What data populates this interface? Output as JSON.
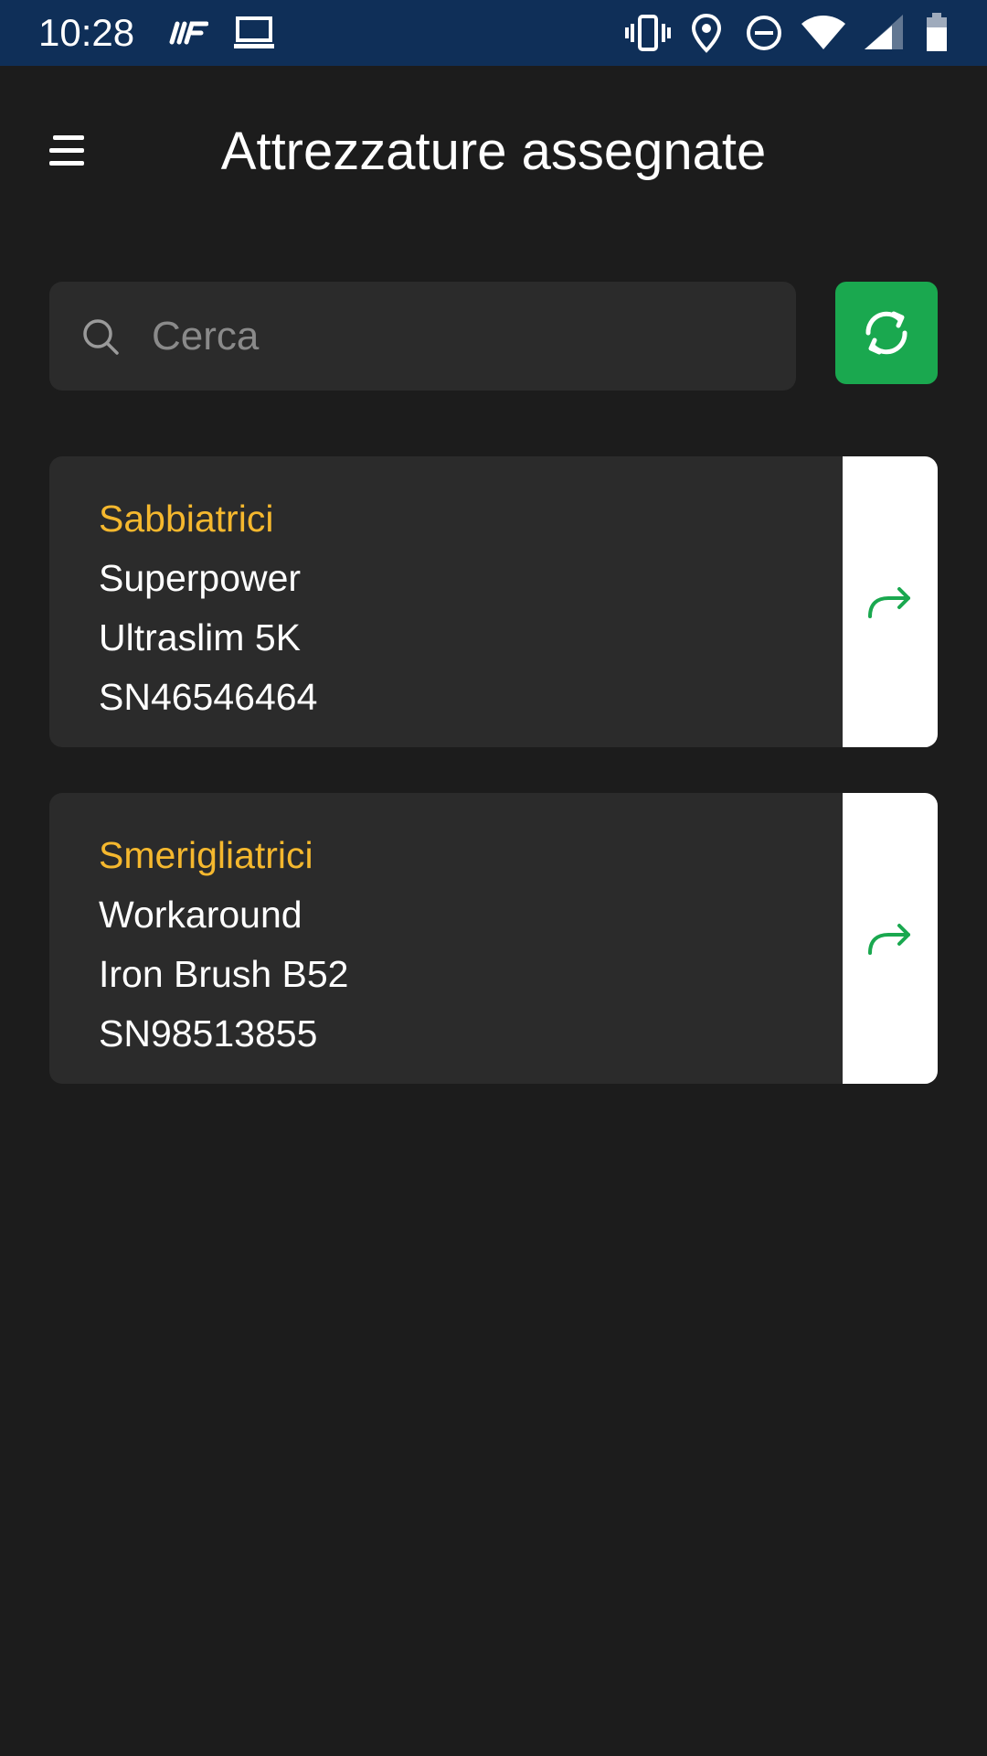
{
  "status_bar": {
    "time": "10:28",
    "icons": [
      "sim-icon",
      "laptop-icon",
      "vibrate-icon",
      "location-icon",
      "do-not-disturb-icon",
      "wifi-icon",
      "signal-icon",
      "battery-icon"
    ]
  },
  "header": {
    "title": "Attrezzature assegnate",
    "menu_icon": "menu-icon"
  },
  "search": {
    "placeholder": "Cerca",
    "value": "",
    "icon": "search-icon"
  },
  "refresh_button": {
    "icon": "refresh-icon",
    "color": "#1aa84f"
  },
  "colors": {
    "accent": "#1aa84f",
    "category": "#f5b82e",
    "status_bar": "#0f2f58",
    "background": "#1c1c1c",
    "card": "#2b2b2b"
  },
  "equipment": [
    {
      "category": "Sabbiatrici",
      "brand": "Superpower",
      "model": "Ultraslim 5K",
      "serial": "SN46546464",
      "action_icon": "arrow-forward-icon"
    },
    {
      "category": "Smerigliatrici",
      "brand": "Workaround",
      "model": "Iron Brush B52",
      "serial": "SN98513855",
      "action_icon": "arrow-forward-icon"
    }
  ]
}
